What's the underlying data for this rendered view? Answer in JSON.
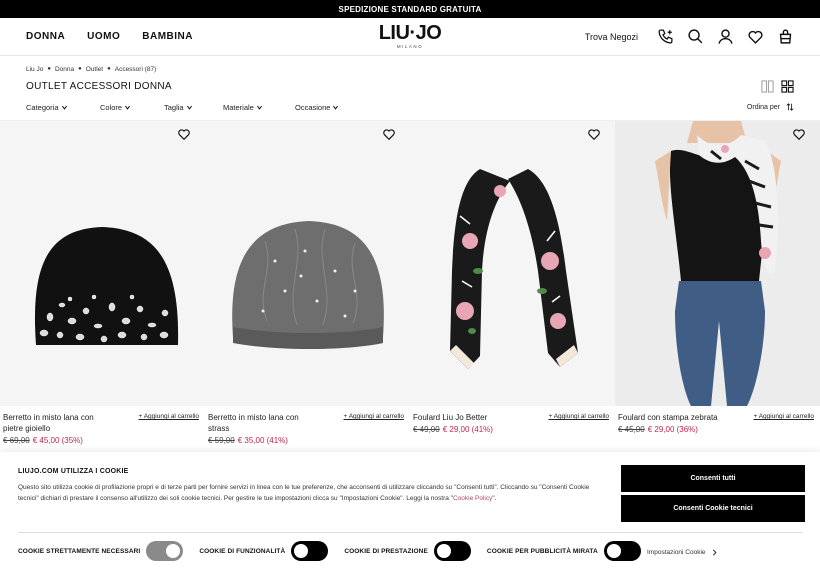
{
  "promo": "SPEDIZIONE STANDARD GRATUITA",
  "nav": [
    "DONNA",
    "UOMO",
    "BAMBINA"
  ],
  "logo": {
    "main": "LIU·JO",
    "sub": "MILANO"
  },
  "header": {
    "store_label": "Trova Negozi",
    "icons": [
      "phone-icon",
      "search-icon",
      "account-icon",
      "wishlist-icon",
      "bag-icon"
    ]
  },
  "breadcrumb": [
    "Liu Jo",
    "Donna",
    "Outlet",
    "Accessori (87)"
  ],
  "page_title": "OUTLET ACCESSORI DONNA",
  "filters": [
    "Categoria",
    "Colore",
    "Taglia",
    "Materiale",
    "Occasione"
  ],
  "sort_label": "Ordina per",
  "products": [
    {
      "name": "Berretto in misto lana con pietre gioiello",
      "old_price": "€ 69,00",
      "new_price": "€ 45,00 (35%)",
      "add_label": "+ Aggiungi al carrello"
    },
    {
      "name": "Berretto in misto lana con strass",
      "old_price": "€ 59,00",
      "new_price": "€ 35,00 (41%)",
      "add_label": "+ Aggiungi al carrello"
    },
    {
      "name": "Foulard Liu Jo Better",
      "old_price": "€ 49,00",
      "new_price": "€ 29,00 (41%)",
      "add_label": "+ Aggiungi al carrello"
    },
    {
      "name": "Foulard con stampa zebrata",
      "old_price": "€ 45,00",
      "new_price": "€ 29,00 (36%)",
      "add_label": "+ Aggiungi al carrello"
    }
  ],
  "cookie": {
    "title": "LIUJO.COM UTILIZZA I COOKIE",
    "text_1": "Questo sito utilizza cookie di profilazione propri e di terze parti per fornire servizi in linea con le tue preferenze, che acconsenti di utilizzare cliccando su \"Consenti tutti\". Cliccando su \"Consenti Cookie tecnici\" dichiari di prestare il consenso all'utilizzo dei soli cookie tecnici. Per gestire le tue impostazioni clicca su \"Impostazioni Cookie\". Leggi la nostra \"",
    "link": "Cookie Policy",
    "text_2": "\".",
    "accept_all": "Consenti tutti",
    "accept_tech": "Consenti Cookie tecnici",
    "toggles": [
      {
        "label": "COOKIE STRETTAMENTE NECESSARI",
        "state": "locked"
      },
      {
        "label": "COOKIE DI FUNZIONALITÀ",
        "state": "off"
      },
      {
        "label": "COOKIE DI PRESTAZIONE",
        "state": "off"
      },
      {
        "label": "COOKIE PER PUBBLICITÀ MIRATA",
        "state": "off"
      }
    ],
    "settings": "Impostazioni Cookie"
  }
}
